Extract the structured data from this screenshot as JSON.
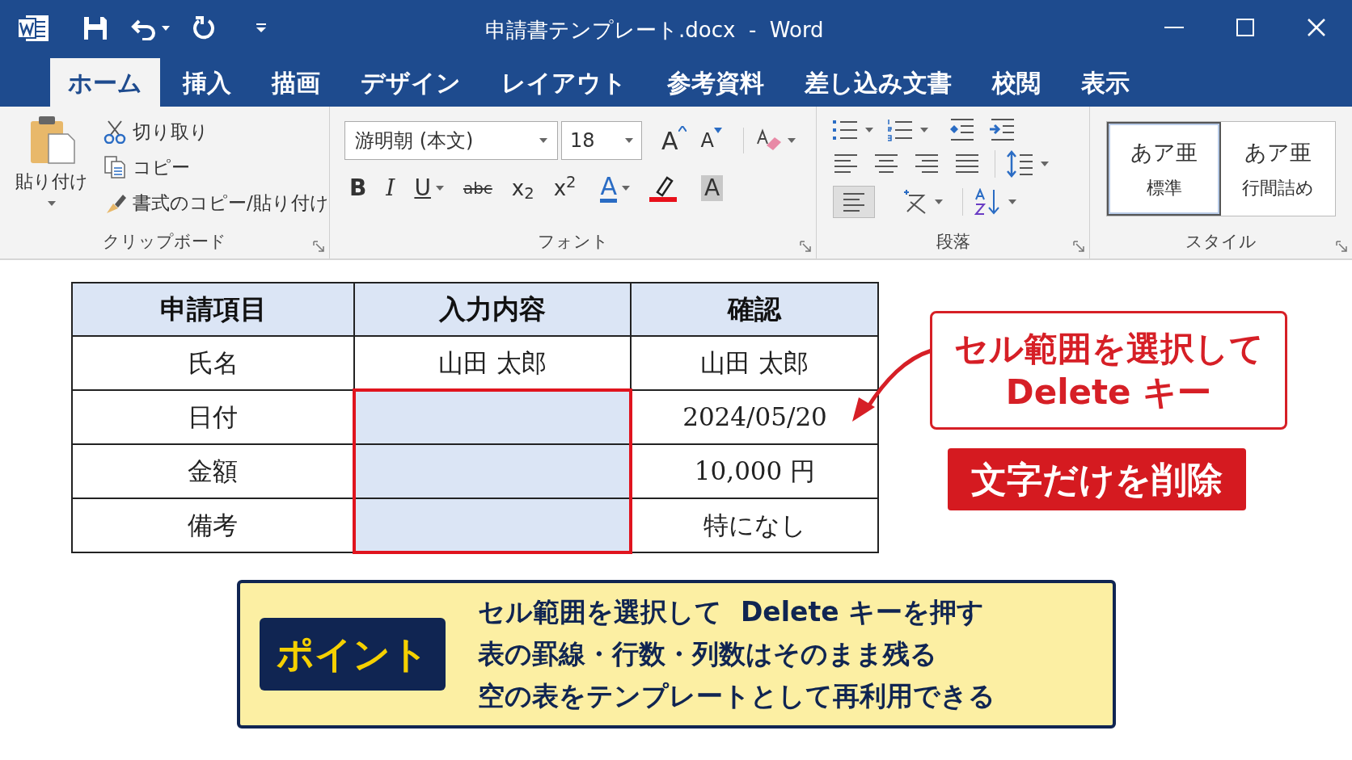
{
  "window": {
    "title": "申請書テンプレート.docx  -  Word"
  },
  "tabs": [
    {
      "label": "ホーム",
      "selected": true
    },
    {
      "label": "挿入",
      "selected": false
    },
    {
      "label": "描画",
      "selected": false
    },
    {
      "label": "デザイン",
      "selected": false
    },
    {
      "label": "レイアウト",
      "selected": false
    },
    {
      "label": "参考資料",
      "selected": false
    },
    {
      "label": "差し込み文書",
      "selected": false
    },
    {
      "label": "校閲",
      "selected": false
    },
    {
      "label": "表示",
      "selected": false
    }
  ],
  "ribbon": {
    "clipboard": {
      "paste": "貼り付け",
      "items": [
        {
          "label": "切り取り",
          "kind": "cut"
        },
        {
          "label": "コピー",
          "kind": "copy"
        },
        {
          "label": "書式のコピー/貼り付け",
          "kind": "painter"
        }
      ],
      "group": "クリップボード"
    },
    "font": {
      "font_name": "游明朝 (本文)",
      "font_size": "18",
      "grow": "A",
      "shrink": "A",
      "buttons": [
        {
          "kind": "bold",
          "label": "B"
        },
        {
          "kind": "italic",
          "label": "I"
        },
        {
          "kind": "underline",
          "label": "U"
        },
        {
          "kind": "strike",
          "label": "abc"
        },
        {
          "kind": "subscript",
          "label": "x$_{2}$"
        },
        {
          "kind": "superscript",
          "label": "x$^{2}$"
        },
        {
          "kind": "font_color",
          "label": "A"
        },
        {
          "kind": "highlight"
        },
        {
          "kind": "shading",
          "label": "A"
        }
      ],
      "group": "フォント"
    },
    "paragraph": {
      "group": "段落"
    },
    "styles": {
      "items": [
        {
          "preview": "あア亜",
          "name": "標準",
          "selected": true
        },
        {
          "preview": "あア亜",
          "name": "行間詰め",
          "selected": false
        }
      ],
      "group": "スタイル"
    }
  },
  "table": {
    "columns": [
      "申請項目",
      "入力内容",
      "確認"
    ],
    "rows": [
      [
        {
          "text": "氏名",
          "selected": false
        },
        {
          "text": "山田 太郎",
          "selected": false
        },
        {
          "text": "山田 太郎",
          "selected": false
        }
      ],
      [
        {
          "text": "日付",
          "selected": false
        },
        {
          "selected": true
        },
        {
          "text": "2024/05/20",
          "selected": false
        }
      ],
      [
        {
          "text": "金額",
          "selected": false
        },
        {
          "selected": true
        },
        {
          "text": "10,000 円",
          "selected": false
        }
      ],
      [
        {
          "text": "備考",
          "selected": false
        },
        {
          "selected": true
        },
        {
          "text": "特になし",
          "selected": false
        }
      ]
    ]
  },
  "callout": {
    "lines": [
      "セル範囲を選択して",
      "Delete キー"
    ]
  },
  "result_label": "文字だけを削除",
  "point": {
    "badge": "ポイント",
    "lines": [
      "セル範囲を選択して  Delete キーを押す",
      "表の罫線・行数・列数はそのまま残る",
      "空の表をテンプレートとして再利用できる"
    ]
  }
}
